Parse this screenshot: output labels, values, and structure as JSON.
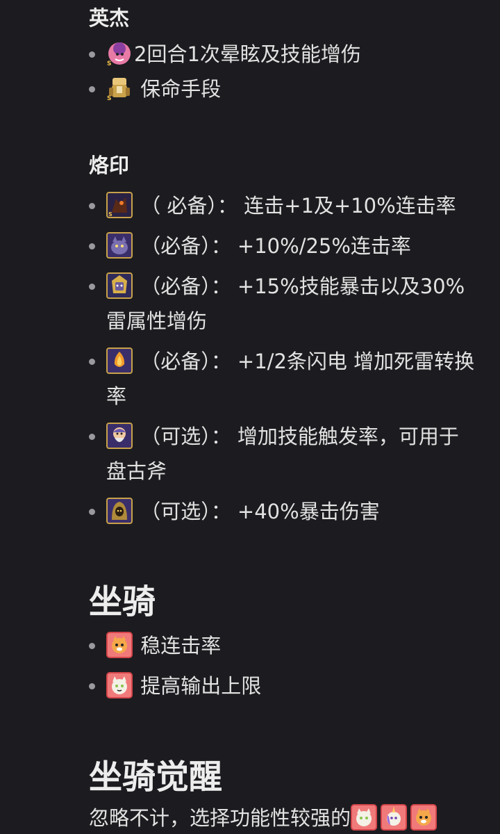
{
  "heroes": {
    "heading": "英杰",
    "items": [
      {
        "icon": "hero-fire-girl-icon",
        "text": "2回合1次晕眩及技能增伤"
      },
      {
        "icon": "hero-armored-knight-icon",
        "text": " 保命手段"
      }
    ]
  },
  "brands": {
    "heading": "烙印",
    "items": [
      {
        "icon": "brand-dark-bird-icon",
        "text": " （ 必备）： 连击+1及+10%连击率"
      },
      {
        "icon": "brand-wolf-icon",
        "text": " （必备）： +10%/25%连击率"
      },
      {
        "icon": "brand-pharaoh-icon",
        "text": " （必备）： +15%技能暴击以及30%雷属性增伤"
      },
      {
        "icon": "brand-fox-icon",
        "text": " （必备）： +1/2条闪电 增加死雷转换率"
      },
      {
        "icon": "brand-old-man-icon",
        "text": " （可选）： 增加技能触发率，可用于盘古斧"
      },
      {
        "icon": "brand-hooded-icon",
        "text": " （可选）： +40%暴击伤害"
      }
    ]
  },
  "mounts": {
    "heading": "坐骑",
    "items": [
      {
        "icon": "mount-orange-beast-icon",
        "text": " 稳连击率"
      },
      {
        "icon": "mount-white-cat-icon",
        "text": " 提高输出上限"
      }
    ]
  },
  "mount_awakening": {
    "heading": "坐骑觉醒",
    "text": "忽略不计，选择功能性较强的",
    "icons": [
      "mount-white-cat-icon",
      "mount-unicorn-icon",
      "mount-orange-beast-icon"
    ]
  },
  "colors": {
    "background": "#1c1c20",
    "text": "#e2e2e2",
    "bullet": "#9a9a9e",
    "icon_border_gold": "#c9a24a",
    "icon_border_red": "#d4464b"
  }
}
